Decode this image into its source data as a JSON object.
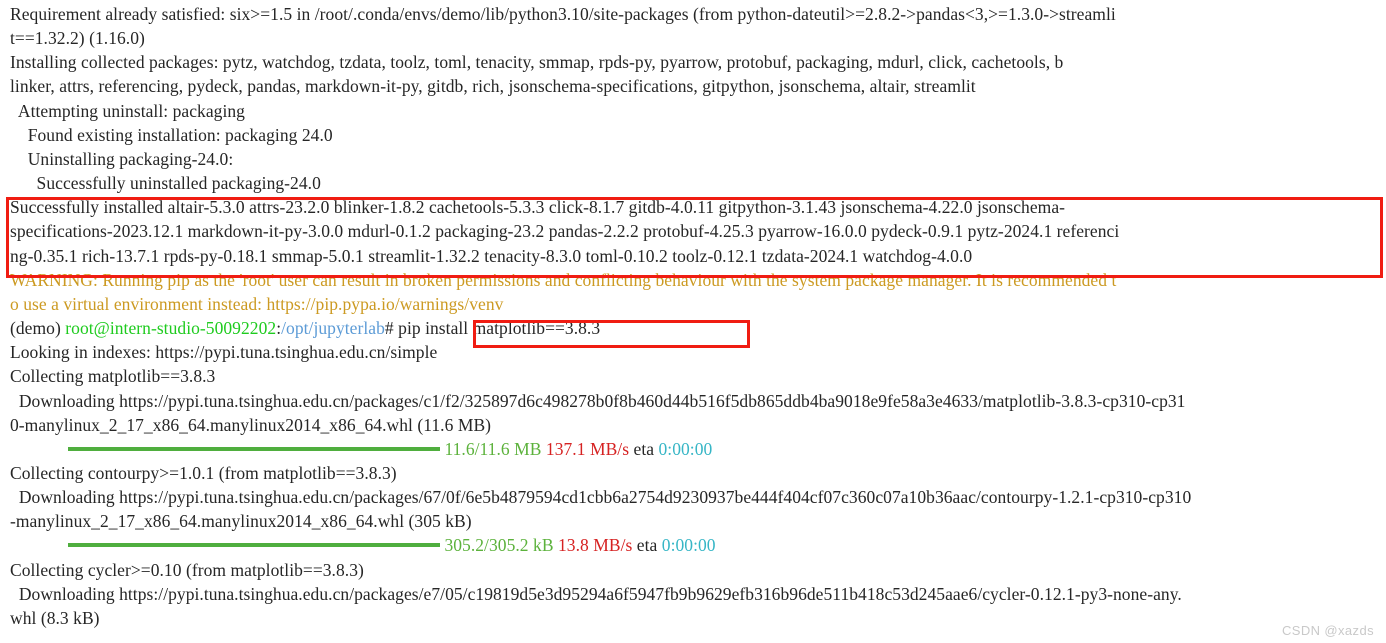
{
  "terminal": {
    "title": "pip install terminal output",
    "colors": {
      "text": "#262626",
      "warning": "#cc9a22",
      "prompt_user": "#1ecb1e",
      "prompt_path": "#5c9bd6",
      "progress_bar": "#4fae3e",
      "progress_size": "#5cb23c",
      "progress_speed": "#d62222",
      "progress_eta": "#37b6c6",
      "annotation_box": "#f01c12",
      "background": "#ffffff"
    },
    "lines": {
      "l1": "Requirement already satisfied: six>=1.5 in /root/.conda/envs/demo/lib/python3.10/site-packages (from python-dateutil>=2.8.2->pandas<3,>=1.3.0->streamli",
      "l2": "t==1.32.2) (1.16.0)",
      "l3": "Installing collected packages: pytz, watchdog, tzdata, toolz, toml, tenacity, smmap, rpds-py, pyarrow, protobuf, packaging, mdurl, click, cachetools, b",
      "l4": "linker, attrs, referencing, pydeck, pandas, markdown-it-py, gitdb, rich, jsonschema-specifications, gitpython, jsonschema, altair, streamlit",
      "l5": "  Attempting uninstall: packaging",
      "l6": "    Found existing installation: packaging 24.0",
      "l7": "    Uninstalling packaging-24.0:",
      "l8": "      Successfully uninstalled packaging-24.0",
      "l9": "Successfully installed altair-5.3.0 attrs-23.2.0 blinker-1.8.2 cachetools-5.3.3 click-8.1.7 gitdb-4.0.11 gitpython-3.1.43 jsonschema-4.22.0 jsonschema-",
      "l10": "specifications-2023.12.1 markdown-it-py-3.0.0 mdurl-0.1.2 packaging-23.2 pandas-2.2.2 protobuf-4.25.3 pyarrow-16.0.0 pydeck-0.9.1 pytz-2024.1 referenci",
      "l11": "ng-0.35.1 rich-13.7.1 rpds-py-0.18.1 smmap-5.0.1 streamlit-1.32.2 tenacity-8.3.0 toml-0.10.2 toolz-0.12.1 tzdata-2024.1 watchdog-4.0.0",
      "l12": "WARNING: Running pip as the 'root' user can result in broken permissions and conflicting behaviour with the system package manager. It is recommended t",
      "l13": "o use a virtual environment instead: https://pip.pypa.io/warnings/venv",
      "l16": "Looking in indexes: https://pypi.tuna.tsinghua.edu.cn/simple",
      "l17": "Collecting matplotlib==3.8.3",
      "l18": "  Downloading https://pypi.tuna.tsinghua.edu.cn/packages/c1/f2/325897d6c498278b0f8b460d44b516f5db865ddb4ba9018e9fe58a3e4633/matplotlib-3.8.3-cp310-cp31",
      "l19": "0-manylinux_2_17_x86_64.manylinux2014_x86_64.whl (11.6 MB)",
      "l21": "Collecting contourpy>=1.0.1 (from matplotlib==3.8.3)",
      "l22": "  Downloading https://pypi.tuna.tsinghua.edu.cn/packages/67/0f/6e5b4879594cd1cbb6a2754d9230937be444f404cf07c360c07a10b36aac/contourpy-1.2.1-cp310-cp310",
      "l23": "-manylinux_2_17_x86_64.manylinux2014_x86_64.whl (305 kB)",
      "l25": "Collecting cycler>=0.10 (from matplotlib==3.8.3)",
      "l26": "  Downloading https://pypi.tuna.tsinghua.edu.cn/packages/e7/05/c19819d5e3d95294a6f5947fb9b9629efb316b96de511b418c53d245aae6/cycler-0.12.1-py3-none-any.",
      "l27": "whl (8.3 kB)"
    },
    "prompt": {
      "env": "(demo) ",
      "user_host": "root@intern-studio-50092202",
      "colon": ":",
      "path": "/opt/jupyterlab",
      "hash": "#",
      "command": " pip install matplotlib==3.8.3"
    },
    "progress_1": {
      "size": "11.6/11.6 MB",
      "speed": "137.1 MB/s",
      "eta_label": "eta",
      "eta": "0:00:00"
    },
    "progress_2": {
      "size": "305.2/305.2 kB",
      "speed": "13.8 MB/s",
      "eta_label": "eta",
      "eta": "0:00:00"
    },
    "watermark": "CSDN @xazds"
  }
}
